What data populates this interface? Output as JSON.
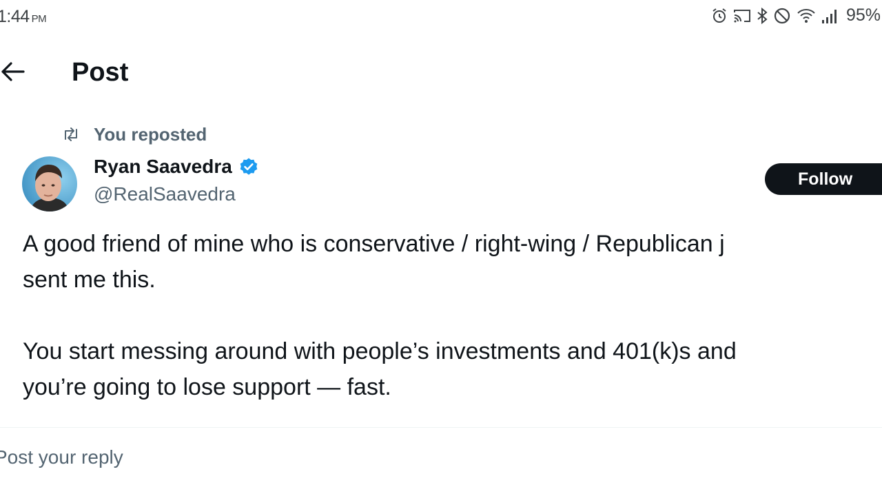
{
  "status_bar": {
    "time": "1:44",
    "ampm": "PM",
    "battery": "95%",
    "icons": [
      "alarm-icon",
      "cast-icon",
      "bluetooth-icon",
      "do-not-disturb-icon",
      "wifi-icon",
      "signal-icon"
    ]
  },
  "header": {
    "back_icon": "arrow-left-icon",
    "title": "Post"
  },
  "tweet": {
    "repost_icon": "repost-icon",
    "repost_label": "You reposted",
    "author": {
      "name": "Ryan Saavedra",
      "handle": "@RealSaavedra",
      "verified": true
    },
    "follow_label": "Follow",
    "paragraphs": [
      [
        "A good friend of mine who is conservative / right-wing / Republican j",
        "sent me this."
      ],
      [
        "You start messing around with people’s investments and 401(k)s and",
        "you’re going to lose support — fast."
      ]
    ]
  },
  "reply": {
    "placeholder": "Post your reply"
  },
  "colors": {
    "text": "#0f1419",
    "secondary": "#536471",
    "verified": "#1d9bf0",
    "follow_bg": "#0f1419"
  }
}
